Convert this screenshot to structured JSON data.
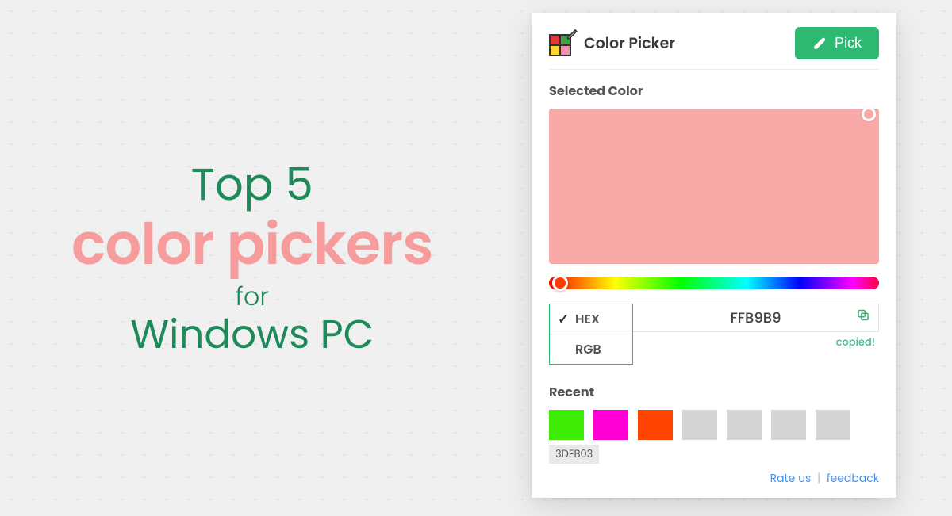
{
  "headline": {
    "line1": "Top 5",
    "line2": "color pickers",
    "line3": "for",
    "line4": "Windows PC"
  },
  "app": {
    "title": "Color Picker",
    "pick_label": "Pick",
    "selected_label": "Selected Color",
    "selected_color": "#f9a8a8",
    "format": {
      "options": [
        "HEX",
        "RGB"
      ],
      "selected": "HEX"
    },
    "value": "FFB9B9",
    "copied_label": "copied!",
    "recent_label": "Recent",
    "recent": [
      {
        "color": "#3DEB03"
      },
      {
        "color": "#ff00d4"
      },
      {
        "color": "#ff4500"
      },
      {
        "color": "#d4d4d4"
      },
      {
        "color": "#d4d4d4"
      },
      {
        "color": "#d4d4d4"
      },
      {
        "color": "#d4d4d4"
      }
    ],
    "recent_hover_hex": "3DEB03",
    "footer": {
      "rate": "Rate us",
      "feedback": "feedback"
    }
  }
}
